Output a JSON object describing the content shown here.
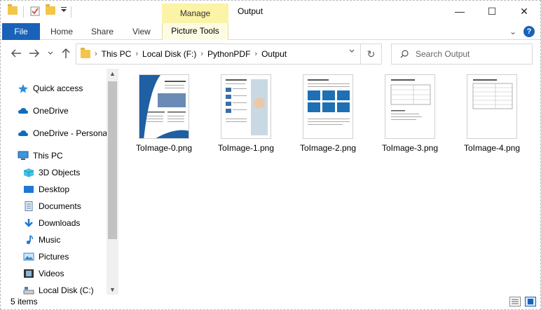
{
  "window": {
    "title": "Output",
    "contextual_tab": "Manage",
    "minimize": "—",
    "maximize": "☐",
    "close": "✕"
  },
  "ribbon": {
    "tabs": [
      "File",
      "Home",
      "Share",
      "View"
    ],
    "contextual_tab": "Picture Tools",
    "collapse": "⌄",
    "help": "?"
  },
  "address": {
    "crumbs": [
      "This PC",
      "Local Disk (F:)",
      "PythonPDF",
      "Output"
    ],
    "refresh": "↻",
    "search_placeholder": "Search Output"
  },
  "nav": {
    "items": [
      {
        "label": "Quick access",
        "icon": "star-icon"
      },
      {
        "label": "OneDrive",
        "icon": "cloud-icon"
      },
      {
        "label": "OneDrive - Personal",
        "icon": "cloud-icon"
      },
      {
        "label": "This PC",
        "icon": "pc-icon"
      },
      {
        "label": "3D Objects",
        "icon": "cube-icon"
      },
      {
        "label": "Desktop",
        "icon": "desktop-icon"
      },
      {
        "label": "Documents",
        "icon": "documents-icon"
      },
      {
        "label": "Downloads",
        "icon": "download-icon"
      },
      {
        "label": "Music",
        "icon": "music-icon"
      },
      {
        "label": "Pictures",
        "icon": "pictures-icon"
      },
      {
        "label": "Videos",
        "icon": "video-icon"
      },
      {
        "label": "Local Disk (C:)",
        "icon": "drive-icon"
      }
    ]
  },
  "files": [
    {
      "name": "ToImage-0.png"
    },
    {
      "name": "ToImage-1.png"
    },
    {
      "name": "ToImage-2.png"
    },
    {
      "name": "ToImage-3.png"
    },
    {
      "name": "ToImage-4.png"
    }
  ],
  "status": {
    "count": "5 items"
  },
  "colors": {
    "accent": "#1a62b8",
    "manage": "#fbf3a6"
  }
}
